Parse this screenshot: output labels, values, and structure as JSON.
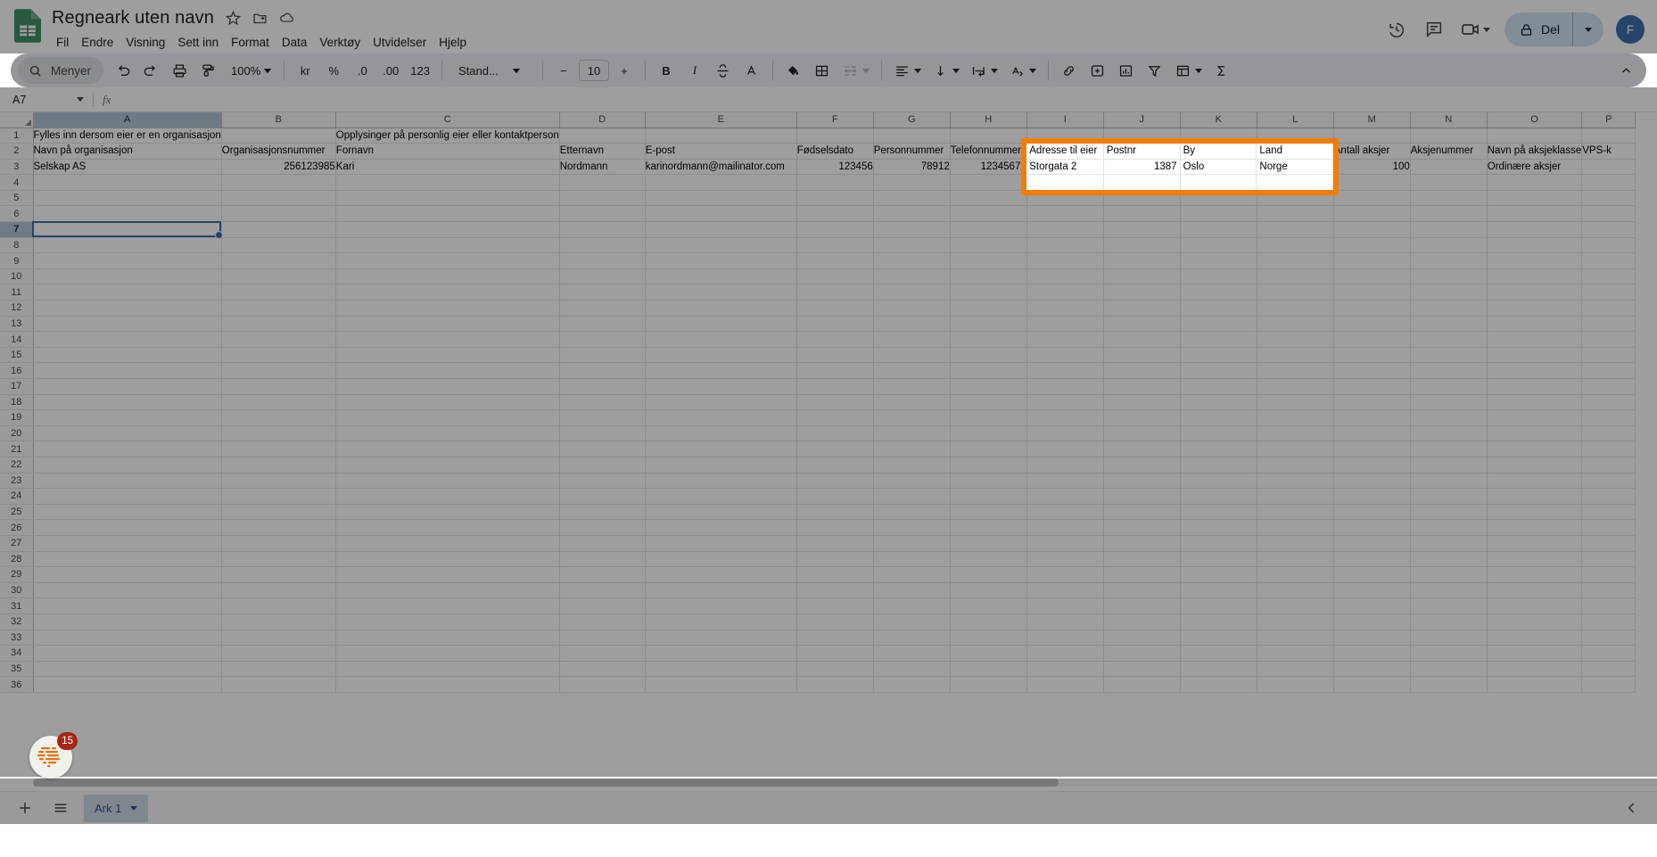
{
  "header": {
    "doc_title": "Regneark uten navn",
    "title_icons": [
      "star-icon",
      "move-to-folder-icon",
      "cloud-saved-icon"
    ],
    "menu": [
      "Fil",
      "Endre",
      "Visning",
      "Sett inn",
      "Format",
      "Data",
      "Verktøy",
      "Utvidelser",
      "Hjelp"
    ],
    "history_icon": "version-history-icon",
    "comment_icon": "comment-icon",
    "meet_icon": "video-camera-icon",
    "share_label": "Del",
    "avatar_initial": "F"
  },
  "toolbar": {
    "search_label": "Menyer",
    "undo": "undo-icon",
    "redo": "redo-icon",
    "print": "print-icon",
    "paint": "paint-format-icon",
    "zoom_value": "100%",
    "currency": "kr",
    "percent": "%",
    "decimal_decrease": ".0",
    "decimal_increase": ".00",
    "number_format": "123",
    "font_name": "Stand...",
    "font_size": "10",
    "minus": "−",
    "plus": "+",
    "bold": "B",
    "italic": "I",
    "strikethrough": "S",
    "text_color": "A"
  },
  "formula_bar": {
    "name_box": "A7",
    "fx": "fx",
    "formula_value": ""
  },
  "grid": {
    "columns": [
      "A",
      "B",
      "C",
      "D",
      "E",
      "F",
      "G",
      "H",
      "I",
      "J",
      "K",
      "L",
      "M",
      "N",
      "O",
      "P"
    ],
    "selected_column": "A",
    "selected_cell": "A7",
    "row_numbers": [
      1,
      2,
      3,
      4,
      5,
      6,
      7,
      8,
      9,
      10,
      11,
      12,
      13,
      14,
      15,
      16,
      17,
      18,
      19,
      20,
      21,
      22,
      23,
      24,
      25,
      26,
      27,
      28,
      29,
      30,
      31,
      32,
      33,
      34,
      35,
      36
    ],
    "rows": [
      {
        "n": 1,
        "cells": [
          {
            "c": "A",
            "v": "Fylles inn dersom eier er en organisasjon",
            "align": "left",
            "span": true
          },
          {
            "c": "C",
            "v": "Opplysinger på personlig eier eller kontaktperson",
            "align": "left",
            "span": true
          }
        ]
      },
      {
        "n": 2,
        "cells": [
          {
            "c": "A",
            "v": "Navn på organisasjon",
            "align": "left"
          },
          {
            "c": "B",
            "v": "Organisasjonsnummer",
            "align": "left"
          },
          {
            "c": "C",
            "v": "Fornavn",
            "align": "left"
          },
          {
            "c": "D",
            "v": "Etternavn",
            "align": "left"
          },
          {
            "c": "E",
            "v": "E-post",
            "align": "left"
          },
          {
            "c": "F",
            "v": "Fødselsdato",
            "align": "left"
          },
          {
            "c": "G",
            "v": "Personnummer",
            "align": "left"
          },
          {
            "c": "H",
            "v": "Telefonnummer",
            "align": "left"
          },
          {
            "c": "M",
            "v": "Antall aksjer",
            "align": "left"
          },
          {
            "c": "N",
            "v": "Aksjenummer",
            "align": "left"
          },
          {
            "c": "O",
            "v": "Navn på aksjeklasse",
            "align": "left"
          },
          {
            "c": "P",
            "v": "VPS-k",
            "align": "left"
          }
        ]
      },
      {
        "n": 3,
        "cells": [
          {
            "c": "A",
            "v": "Selskap AS",
            "align": "left"
          },
          {
            "c": "B",
            "v": "256123985",
            "align": "right"
          },
          {
            "c": "C",
            "v": "Kari",
            "align": "left"
          },
          {
            "c": "D",
            "v": "Nordmann",
            "align": "left"
          },
          {
            "c": "E",
            "v": "karinordmann@mailinator.com",
            "align": "left"
          },
          {
            "c": "F",
            "v": "123456",
            "align": "right"
          },
          {
            "c": "G",
            "v": "78912",
            "align": "right"
          },
          {
            "c": "H",
            "v": "12345678",
            "align": "right"
          },
          {
            "c": "M",
            "v": "100",
            "align": "right"
          },
          {
            "c": "O",
            "v": "Ordinære aksjer",
            "align": "left"
          }
        ]
      }
    ]
  },
  "highlight": {
    "border_color": "#f57c00",
    "header_row": [
      "Adresse til eier",
      "Postnr",
      "By",
      "Land"
    ],
    "data_row": [
      "Storgata 2",
      "1387",
      "Oslo",
      "Norge"
    ],
    "aligns": [
      "left",
      "right",
      "left",
      "left"
    ]
  },
  "ai_fab": {
    "icon": "gemini-sparkle-icon",
    "badge_count": "15"
  },
  "bottom": {
    "add_sheet_icon": "add-sheet-icon",
    "all_sheets_icon": "all-sheets-icon",
    "sheet_tab_label": "Ark 1",
    "sheet_tab_caret": "chevron-down-icon",
    "collapse_icon": "chevron-left-icon"
  }
}
